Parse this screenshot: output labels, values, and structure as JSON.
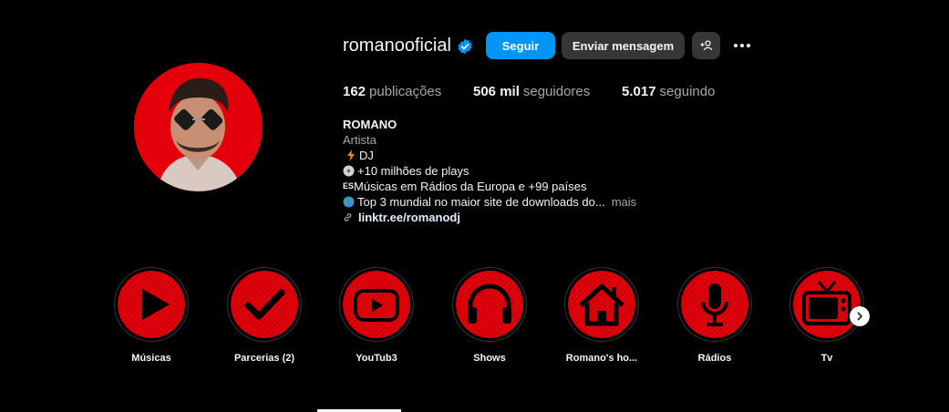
{
  "profile": {
    "username": "romanooficial",
    "verified": true,
    "follow_label": "Seguir",
    "message_label": "Enviar mensagem",
    "stats": {
      "posts_count": "162",
      "posts_label": "publicações",
      "followers_count": "506 mil",
      "followers_label": "seguidores",
      "following_count": "5.017",
      "following_label": "seguindo"
    },
    "bio": {
      "name": "ROMANO",
      "category": "Artista",
      "line1": "DJ",
      "line2": "+10 milhões de plays",
      "line3_prefix": "ES",
      "line3": "Músicas em Rádios da Europa e +99 países",
      "line4": "Top 3 mundial no maior site de downloads do...",
      "more_label": "mais",
      "link": "linktr.ee/romanodj"
    }
  },
  "highlights": [
    {
      "label": "Músicas",
      "icon": "play-icon"
    },
    {
      "label": "Parcerias (2)",
      "icon": "checkmark-icon"
    },
    {
      "label": "YouTub3",
      "icon": "youtube-icon"
    },
    {
      "label": "Shows",
      "icon": "headphones-icon"
    },
    {
      "label": "Romano's ho...",
      "icon": "house-icon"
    },
    {
      "label": "Rádios",
      "icon": "microphone-icon"
    },
    {
      "label": "Tv",
      "icon": "tv-icon"
    }
  ],
  "colors": {
    "accent": "#0095f6",
    "highlight_red": "#e3000b",
    "verified": "#0095f6"
  }
}
